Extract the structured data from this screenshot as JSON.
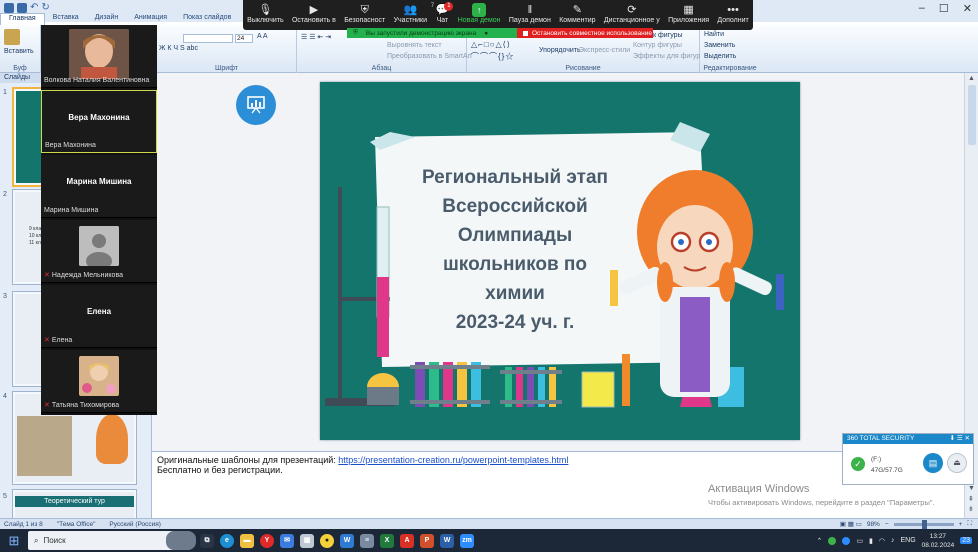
{
  "ppt": {
    "tabs": [
      "Главная",
      "Вставка",
      "Дизайн",
      "Анимация",
      "Показ слайдов"
    ],
    "ribbon": {
      "paste": "Вставить",
      "clipboard": "Буф",
      "font_group": "Шрифт",
      "font_size": "24",
      "paragraph_group": "Абзац",
      "align_text": "Выровнять текст",
      "convert_smartart": "Преобразовать в SmartArt",
      "arrange": "Упорядочить",
      "express_styles": "Экспресс-стили",
      "drawing_group": "Рисование",
      "shape_fill": "к фигуры",
      "shape_outline": "Контур фигуры",
      "shape_effects": "Эффекты для фигур",
      "find": "Найти",
      "replace": "Заменить",
      "select": "Выделить",
      "editing_group": "Редактирование"
    },
    "slides_pane_label": "Слайды",
    "thumb_numbers": [
      "1",
      "2",
      "3",
      "4",
      "5"
    ],
    "thumb_bullets": [
      "9 клас",
      "10 кла",
      "11 кла"
    ],
    "thumb5_title": "Теоретический тур",
    "notes_line1": "Оригинальные шаблоны для презентаций: ",
    "notes_link": "https://presentation-creation.ru/powerpoint-templates.html",
    "notes_line2": "Бесплатно и без регистрации.",
    "status": {
      "slide": "Слайд 1 из 8",
      "theme": "\"Тема Office\"",
      "language": "Русский (Россия)",
      "zoom": "98%"
    }
  },
  "slide": {
    "title_lines": [
      "Региональный этап",
      "Всероссийской",
      "Олимпиады",
      "школьников по",
      "химии",
      "2023-24 уч. г."
    ]
  },
  "zoom": {
    "toolbar": [
      {
        "label": "Выключить",
        "icon": "microphone-icon"
      },
      {
        "label": "Остановить в",
        "icon": "video-camera-icon"
      },
      {
        "label": "Безопасност",
        "icon": "shield-icon"
      },
      {
        "label": "Участники",
        "icon": "participants-icon",
        "count": "7"
      },
      {
        "label": "Чат",
        "icon": "chat-icon",
        "badge": "1"
      },
      {
        "label": "Новая демон",
        "icon": "share-screen-icon"
      },
      {
        "label": "Пауза демон",
        "icon": "pause-icon"
      },
      {
        "label": "Комментир",
        "icon": "annotate-pen-icon"
      },
      {
        "label": "Дистанционное у",
        "icon": "remote-control-icon"
      },
      {
        "label": "Приложения",
        "icon": "apps-icon"
      },
      {
        "label": "Дополнит",
        "icon": "more-icon"
      }
    ],
    "share_notice": "Вы запустили демонстрацию экрана",
    "stop_share": "Остановить совместное использование",
    "participants": [
      {
        "name": "Волкова Наталия Валентиновна",
        "big": "",
        "muted": false,
        "photo": "woman-photo"
      },
      {
        "name": "Вера Махонина",
        "big": "Вера Махонина",
        "muted": false,
        "photo": ""
      },
      {
        "name": "Марина Мишина",
        "big": "Марина Мишина",
        "muted": false,
        "photo": ""
      },
      {
        "name": "Надежда Мельникова",
        "big": "",
        "muted": true,
        "photo": "avatar-placeholder"
      },
      {
        "name": "Елена",
        "big": "Елена",
        "muted": true,
        "photo": ""
      },
      {
        "name": "Татьяна Тихомирова",
        "big": "",
        "muted": true,
        "photo": "woman-flowers-photo"
      }
    ]
  },
  "security": {
    "title": "360 TOTAL SECURITY",
    "drive": "(F:)",
    "usage": "47G/57.7G"
  },
  "activation": {
    "title": "Активация Windows",
    "subtitle": "Чтобы активировать Windows, перейдите в раздел \"Параметры\"."
  },
  "taskbar": {
    "search": "Поиск",
    "lang": "ENG",
    "time": "13:27",
    "date": "08.02.2024",
    "notif": "23"
  },
  "colors": {
    "slide_teal": "#14756c",
    "zoom_green": "#22b14c",
    "zoom_red": "#e02020",
    "ribbon_blue": "#dbe7f5"
  }
}
